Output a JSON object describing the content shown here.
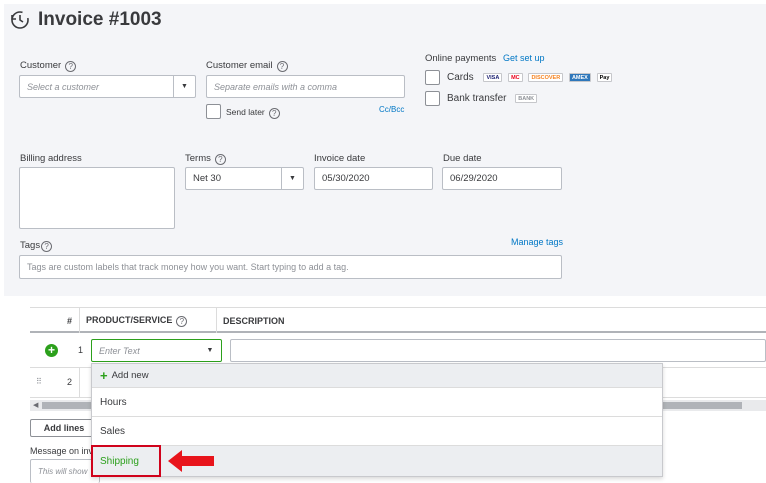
{
  "header": {
    "title": "Invoice #1003"
  },
  "customer": {
    "label": "Customer",
    "placeholder": "Select a customer"
  },
  "email": {
    "label": "Customer email",
    "placeholder": "Separate emails with a comma",
    "send_later": "Send later",
    "cc_bcc": "Cc/Bcc"
  },
  "payments": {
    "label": "Online payments",
    "setup_link": "Get set up",
    "cards_label": "Cards",
    "card_brands": [
      "VISA",
      "MC",
      "DISCOVER",
      "AMEX",
      "Pay"
    ],
    "bank_label": "Bank transfer",
    "bank_badge": "BANK"
  },
  "billing": {
    "label": "Billing address"
  },
  "terms": {
    "label": "Terms",
    "value": "Net 30"
  },
  "invoice_date": {
    "label": "Invoice date",
    "value": "05/30/2020"
  },
  "due_date": {
    "label": "Due date",
    "value": "06/29/2020"
  },
  "tags": {
    "label": "Tags",
    "manage_link": "Manage tags",
    "placeholder": "Tags are custom labels that track money how you want. Start typing to add a tag."
  },
  "table": {
    "headers": {
      "num": "#",
      "product": "PRODUCT/SERVICE",
      "description": "DESCRIPTION"
    },
    "rows": [
      {
        "num": "1",
        "product_placeholder": "Enter Text"
      },
      {
        "num": "2"
      }
    ]
  },
  "dropdown": {
    "add_new": "Add new",
    "items": [
      "Hours",
      "Sales",
      "Shipping"
    ]
  },
  "footer": {
    "add_lines": "Add lines",
    "message_label": "Message on inv",
    "message_placeholder": "This will show"
  },
  "colors": {
    "accent_green": "#2ca01c",
    "link_blue": "#0077c5",
    "callout_red": "#d0021b"
  }
}
